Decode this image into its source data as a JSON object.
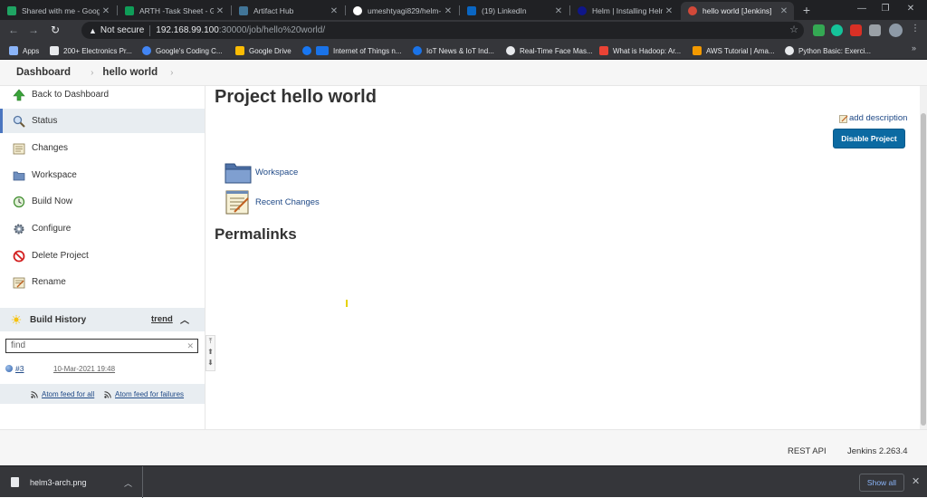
{
  "browser": {
    "tabs": [
      {
        "title": "Shared with me - Goog",
        "favicon_color": "#1fa463"
      },
      {
        "title": "ARTH -Task Sheet - Goo",
        "favicon_color": "#0f9d58"
      },
      {
        "title": "Artifact Hub",
        "favicon_color": "#417598"
      },
      {
        "title": "umeshtyagi829/helm-",
        "favicon_color": "#ffffff"
      },
      {
        "title": "(19) LinkedIn",
        "favicon_color": "#0a66c2"
      },
      {
        "title": "Helm | Installing Helm",
        "favicon_color": "#0f1689"
      },
      {
        "title": "hello world [Jenkins]",
        "favicon_color": "#d24939"
      }
    ],
    "url": {
      "security_label": "Not secure",
      "host": "192.168.99.100",
      "path": ":30000/job/hello%20world/"
    },
    "bookmarks": [
      {
        "label": "Apps",
        "color": "#8ab4f8"
      },
      {
        "label": "200+ Electronics Pr...",
        "color": "#e8eaed"
      },
      {
        "label": "Google's Coding C...",
        "color": "#4285f4"
      },
      {
        "label": "Google Drive",
        "color": "#fbbc04"
      },
      {
        "label": "Internet of Things n...",
        "color": "#1877f2"
      },
      {
        "label": "IoT News & IoT Ind...",
        "color": "#1a73e8"
      },
      {
        "label": "Real-Time Face Mas...",
        "color": "#e8eaed"
      },
      {
        "label": "What is Hadoop: Ar...",
        "color": "#ea4335"
      },
      {
        "label": "AWS Tutorial | Ama...",
        "color": "#f29900"
      },
      {
        "label": "Python Basic: Exerci...",
        "color": "#e8eaed"
      }
    ]
  },
  "breadcrumb": {
    "root": "Dashboard",
    "current": "hello world"
  },
  "sidebar": {
    "items": [
      {
        "label": "Back to Dashboard",
        "icon": "up-arrow-icon"
      },
      {
        "label": "Status",
        "icon": "magnifier-icon"
      },
      {
        "label": "Changes",
        "icon": "notepad-icon"
      },
      {
        "label": "Workspace",
        "icon": "folder-icon"
      },
      {
        "label": "Build Now",
        "icon": "clock-icon"
      },
      {
        "label": "Configure",
        "icon": "gear-icon"
      },
      {
        "label": "Delete Project",
        "icon": "no-entry-icon"
      },
      {
        "label": "Rename",
        "icon": "notepad-pen-icon"
      }
    ],
    "build_history": {
      "title": "Build History",
      "trend": "trend",
      "find_value": "find",
      "builds": [
        {
          "number": "#3",
          "date": "10-Mar-2021 19:48"
        }
      ],
      "feed_all": "Atom feed for all",
      "feed_failures": "Atom feed for failures"
    }
  },
  "main": {
    "title": "Project hello world",
    "add_description": "add description",
    "disable_button": "Disable Project",
    "links": [
      {
        "label": "Workspace"
      },
      {
        "label": "Recent Changes"
      }
    ],
    "permalinks_heading": "Permalinks"
  },
  "footer": {
    "rest_api": "REST API",
    "version": "Jenkins 2.263.4"
  },
  "downloads": {
    "file": "helm3-arch.png",
    "show_all": "Show all"
  }
}
